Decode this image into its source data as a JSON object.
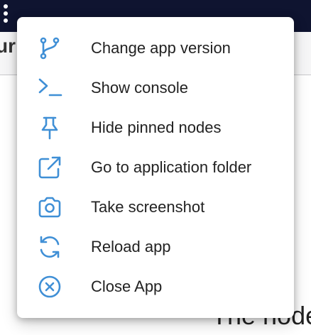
{
  "accent_color": "#3f8fd6",
  "header": {
    "more_icon": "kebab-menu-icon",
    "title_fragment": "ur"
  },
  "content": {
    "visible_text_fragment": "The node"
  },
  "menu": {
    "items": [
      {
        "label": "Change app version",
        "icon": "git-branch-icon"
      },
      {
        "label": "Show console",
        "icon": "terminal-icon"
      },
      {
        "label": "Hide pinned nodes",
        "icon": "pin-icon"
      },
      {
        "label": "Go to application folder",
        "icon": "external-link-icon"
      },
      {
        "label": "Take screenshot",
        "icon": "camera-icon"
      },
      {
        "label": "Reload app",
        "icon": "refresh-icon"
      },
      {
        "label": "Close App",
        "icon": "close-circle-icon"
      }
    ]
  }
}
